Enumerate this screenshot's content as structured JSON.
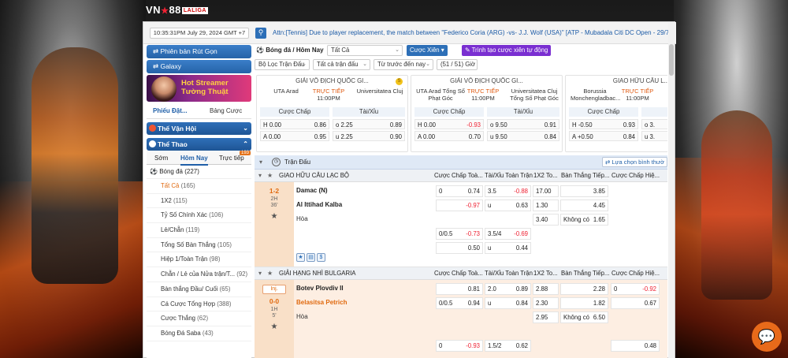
{
  "brand": {
    "name": "VN",
    "star": "★",
    "num": "88",
    "sub": "LALIGA"
  },
  "topbar": {
    "clock": "10:35:31PM July 29, 2024 GMT +7",
    "ticker": "Attn:[Tennis] Due to player replacement, the match between \"Federico Coria (ARG) -vs- J.J. Wolf (USA)\" [ATP - Mubadala Citi DC Open - 29/7]. All bets"
  },
  "sidebar": {
    "buttons": [
      "Phiên bản Rút Gọn",
      "Galaxy"
    ],
    "banner": {
      "line1": "Hot Streamer",
      "line2": "Tường Thuật"
    },
    "tabs": [
      "Phiếu Đặt...",
      "Bảng Cược"
    ],
    "cats": [
      "Thế Vận Hội",
      "Thể Thao"
    ],
    "daytabs": [
      "Sớm",
      "Hôm Nay",
      "Trực tiếp"
    ],
    "live_badge": "193",
    "sport": {
      "name": "Bóng đá",
      "count": "(227)"
    },
    "markets": [
      {
        "label": "Tất Cả",
        "count": "(165)"
      },
      {
        "label": "1X2",
        "count": "(115)"
      },
      {
        "label": "Tỷ Số Chính Xác",
        "count": "(106)"
      },
      {
        "label": "Lẻ/Chẵn",
        "count": "(119)"
      },
      {
        "label": "Tổng Số Bàn Thắng",
        "count": "(105)"
      },
      {
        "label": "Hiệp 1/Toàn Trận",
        "count": "(98)"
      },
      {
        "label": "Chẵn / Lẻ của Nửa trận/T...",
        "count": "(92)"
      },
      {
        "label": "Bàn thắng Đầu/ Cuối",
        "count": "(65)"
      },
      {
        "label": "Cá Cược Tổng Hợp",
        "count": "(388)"
      },
      {
        "label": "Cược Thắng",
        "count": "(62)"
      },
      {
        "label": "Bóng Đá Saba",
        "count": "(43)"
      }
    ]
  },
  "toolbar": {
    "title": "Bóng đá / Hôm Nay",
    "select": "Tất Cả",
    "parlay": "Cược Xiên",
    "builder": "Trình tạo cược xiên tự động"
  },
  "filters": {
    "f1": "Bộ Lọc Trận Đấu",
    "f2": "Tất cả trận đấu",
    "f3": "Từ trước đến nay",
    "count": "(51 / 51) Giờ"
  },
  "cards": [
    {
      "league": "GIẢI VÔ ĐỊCH QUỐC GI...",
      "home": "UTA Arad",
      "away": "Universitatea Cluj",
      "live": "TRỰC TIẾP",
      "time": "11:00PM",
      "coin": "S",
      "h_hdr": "Cược Chấp",
      "ou_hdr": "Tài/Xỉu",
      "rows": [
        [
          "H",
          "0.00",
          "0.86",
          "o",
          "2.25",
          "0.89"
        ],
        [
          "A",
          "0.00",
          "0.95",
          "u",
          "2.25",
          "0.90"
        ]
      ]
    },
    {
      "league": "GIẢI VÔ ĐỊCH QUỐC GI...",
      "home": "UTA Arad Tổng Số Phạt Góc",
      "away": "Universitatea Cluj Tổng Số Phạt Góc",
      "live": "TRỰC TIẾP",
      "time": "11:00PM",
      "h_hdr": "Cược Chấp",
      "ou_hdr": "Tài/Xỉu",
      "rows": [
        [
          "H",
          "0.00",
          "-0.93",
          "o",
          "9.50",
          "0.91"
        ],
        [
          "A",
          "0.00",
          "0.70",
          "u",
          "9.50",
          "0.84"
        ]
      ]
    },
    {
      "league": "GIAO HỮU CÂU L...",
      "home": "Borussia Monchengladbac...",
      "away": "",
      "live": "TRỰC TIẾP",
      "time": "11:00PM",
      "h_hdr": "Cược Chấp",
      "ou_hdr": "",
      "rows": [
        [
          "H",
          "-0.50",
          "0.93",
          "o",
          "3.",
          ""
        ],
        [
          "A",
          "+0.50",
          "0.84",
          "u",
          "3.",
          ""
        ]
      ]
    }
  ],
  "table": {
    "section": "Trận Đấu",
    "pick_btn": "Lựa chọn bình thườ",
    "cols": [
      "Cược Chấp Toà...",
      "Tài/Xỉu Toàn Trận",
      "1X2 To...",
      "Bàn Thắng Tiếp...",
      "Cược Chấp Hiệ..."
    ],
    "leagues": [
      "GIAO HỮU CÂU LẠC BỘ",
      "GIẢI HẠNG NHÌ BULGARIA"
    ],
    "m1": {
      "score": "1-2",
      "half": "2H",
      "min": "36'",
      "home": "Damac (N)",
      "away": "Al Ittihad Kalba",
      "draw": "Hòa",
      "hc": [
        [
          "0",
          "0.74"
        ],
        [
          "",
          "-0.97"
        ],
        [
          "0/0.5",
          "-0.73"
        ],
        [
          "",
          "0.50"
        ]
      ],
      "ou": [
        [
          "3.5",
          "-0.88"
        ],
        [
          "u",
          "0.63"
        ],
        [
          "3.5/4",
          "-0.69"
        ],
        [
          "u",
          "0.44"
        ]
      ],
      "x12": [
        "17.00",
        "1.30",
        "3.40"
      ],
      "next": [
        [
          "",
          "3.85"
        ],
        [
          "",
          "4.45"
        ],
        [
          "Không có",
          "1.65"
        ]
      ]
    },
    "m2": {
      "tag": "Inj.",
      "score": "0-0",
      "half": "1H",
      "min": "5'",
      "home": "Botev Plovdiv II",
      "away": "Belasitsa Petrich",
      "draw": "Hòa",
      "hc": [
        [
          "",
          "0.81"
        ],
        [
          "0/0.5",
          "0.94"
        ],
        [
          "0",
          "-0.93"
        ]
      ],
      "ou": [
        [
          "2.0",
          "0.89"
        ],
        [
          "u",
          "0.84"
        ],
        [
          "1.5/2",
          "0.62"
        ]
      ],
      "x12": [
        "2.88",
        "2.30",
        "2.95"
      ],
      "next": [
        [
          "",
          "2.28"
        ],
        [
          "",
          "1.82"
        ],
        [
          "Không có",
          "6.50"
        ]
      ],
      "hh": [
        [
          "0",
          "-0.92"
        ],
        [
          "",
          "0.67"
        ],
        [
          "",
          "0.48"
        ]
      ]
    }
  }
}
